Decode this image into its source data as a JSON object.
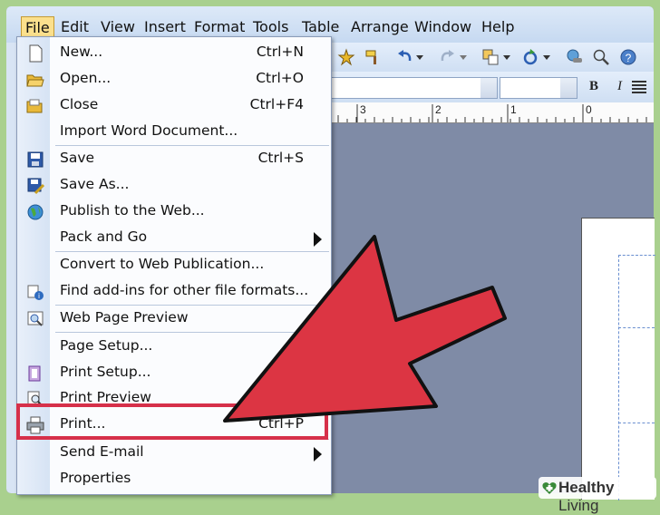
{
  "menubar": {
    "items": [
      "File",
      "Edit",
      "View",
      "Insert",
      "Format",
      "Tools",
      "Table",
      "Arrange",
      "Window",
      "Help"
    ],
    "active": "File"
  },
  "ruler": {
    "labels": [
      "3",
      "2",
      "1",
      "0"
    ]
  },
  "file_menu": {
    "items": [
      {
        "label": "New...",
        "shortcut": "Ctrl+N",
        "icon": "new-document-icon"
      },
      {
        "label": "Open...",
        "shortcut": "Ctrl+O",
        "icon": "open-folder-icon"
      },
      {
        "label": "Close",
        "shortcut": "Ctrl+F4",
        "icon": "close-folder-icon"
      },
      {
        "label": "Import Word Document...",
        "shortcut": "",
        "icon": ""
      },
      {
        "label": "Save",
        "shortcut": "Ctrl+S",
        "icon": "save-icon"
      },
      {
        "label": "Save As...",
        "shortcut": "",
        "icon": "save-as-icon"
      },
      {
        "label": "Publish to the Web...",
        "shortcut": "",
        "icon": "globe-icon"
      },
      {
        "label": "Pack and Go",
        "shortcut": "",
        "icon": "",
        "submenu": true
      },
      {
        "label": "Convert to Web Publication...",
        "shortcut": "",
        "icon": ""
      },
      {
        "label": "Find add-ins for other file formats...",
        "shortcut": "",
        "icon": "add-ins-icon"
      },
      {
        "label": "Web Page Preview",
        "shortcut": "",
        "icon": "web-preview-icon"
      },
      {
        "label": "Page Setup...",
        "shortcut": "",
        "icon": ""
      },
      {
        "label": "Print Setup...",
        "shortcut": "",
        "icon": "print-setup-icon"
      },
      {
        "label": "Print Preview",
        "shortcut": "",
        "icon": "print-preview-icon"
      },
      {
        "label": "Print...",
        "shortcut": "Ctrl+P",
        "icon": "printer-icon"
      },
      {
        "label": "Send E-mail",
        "shortcut": "",
        "icon": "",
        "submenu": true
      },
      {
        "label": "Properties",
        "shortcut": "",
        "icon": ""
      }
    ]
  },
  "watermark": {
    "brand": "Healthy",
    "brand2": " Living"
  },
  "colors": {
    "accent": "#d6304a",
    "menubar": "#c6d9f1",
    "workspace": "#7f8ba6",
    "frame_bg": "#a9d08e"
  }
}
